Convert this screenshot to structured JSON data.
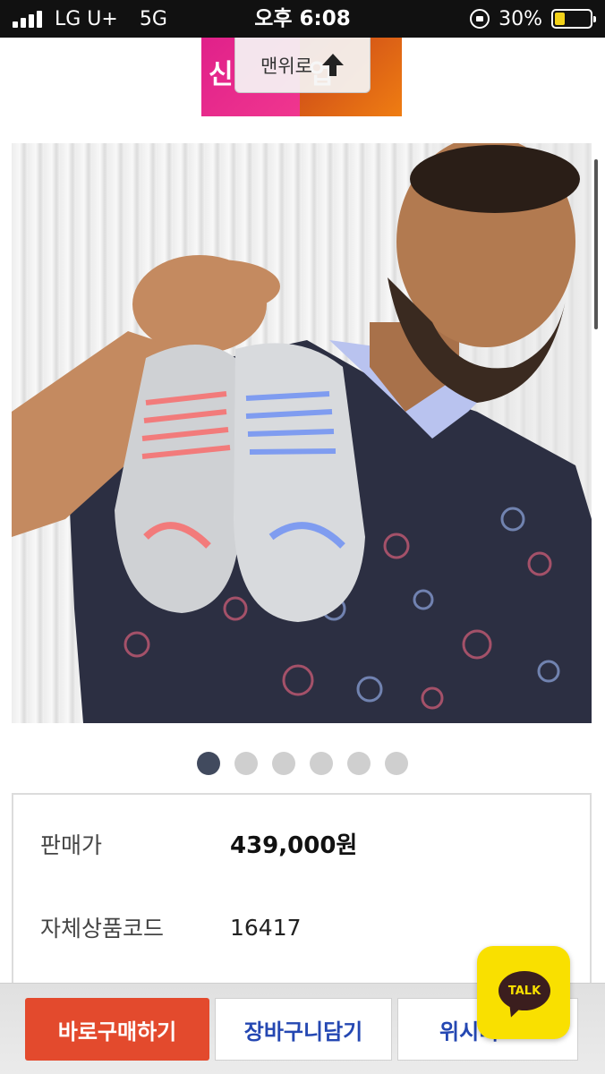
{
  "status_bar": {
    "carrier": "LG U+",
    "network": "5G",
    "time": "오후 6:08",
    "battery_text": "30%",
    "battery_level": 0.3,
    "battery_color": "#f2d21a"
  },
  "banner": {
    "left_text": "신",
    "right_text": "업"
  },
  "scroll_top": {
    "label": "맨위로",
    "icon": "up-arrow-icon"
  },
  "gallery": {
    "image_alt": "product photo",
    "dots_total": 6,
    "active_index": 0
  },
  "product_info": {
    "price_label": "판매가",
    "price_value": "439,000원",
    "code_label": "자체상품코드",
    "code_value": "16417"
  },
  "actions": {
    "buy_now": "바로구매하기",
    "add_to_cart": "장바구니담기",
    "wishlist": "위시리"
  },
  "chat": {
    "label": "TALK",
    "color": "#f9e000"
  }
}
